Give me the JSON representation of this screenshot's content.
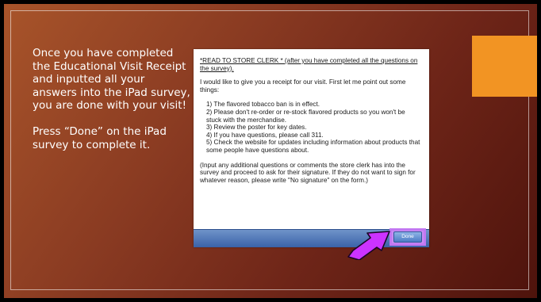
{
  "slide": {
    "instructions": [
      "Once you have completed the Educational Visit Receipt and inputted all your answers into the iPad survey, you are done with your visit!",
      "Press “Done” on the iPad survey to complete it."
    ]
  },
  "ipad": {
    "heading": "*READ TO STORE CLERK * (after you have completed all the questions on the survey).",
    "intro": "I would like to give you a receipt for our visit. First let me point out some things:",
    "points": [
      "1) The flavored tobacco ban is in effect.",
      "2) Please don't re-order or re-stock flavored products so you won't be stuck with the merchandise.",
      "3) Review the poster for key dates.",
      "4) If you have questions, please call 311.",
      "5) Check the website for updates including information about products that some people have questions about."
    ],
    "note": "(Input any additional questions or comments the store clerk has into the survey and proceed to ask for their signature. If they do not want to sign for whatever reason, please write \"No signature\" on the form.)",
    "done_label": "Done"
  },
  "colors": {
    "accent": "#f29423",
    "highlight": "#c277f2",
    "arrow": "#cc33ff"
  },
  "icons": {
    "arrow": "arrow-pointer-icon"
  }
}
